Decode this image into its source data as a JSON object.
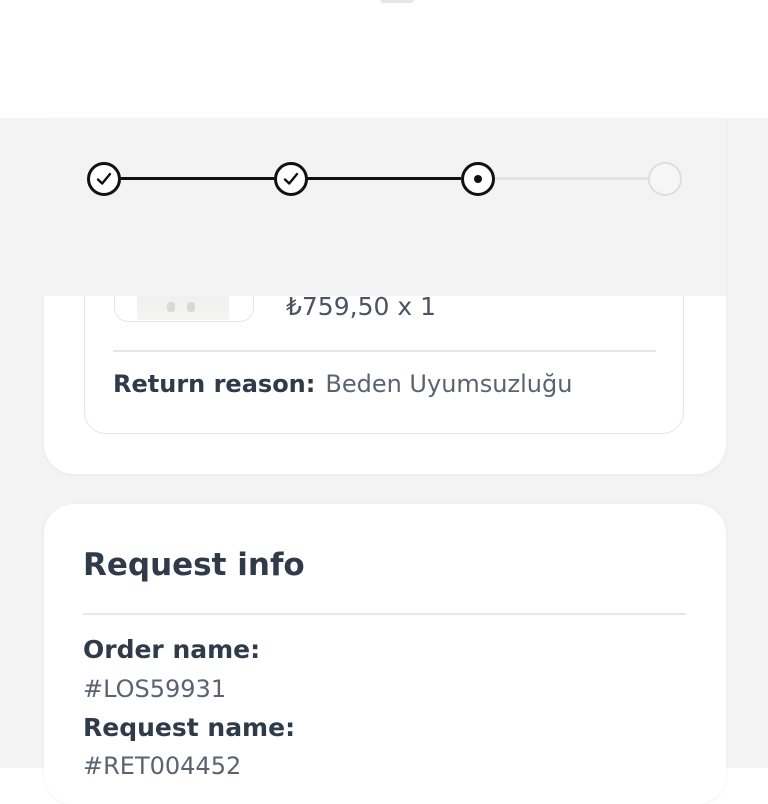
{
  "stepper": {
    "steps": [
      {
        "status": "done",
        "icon": "check-icon"
      },
      {
        "status": "done",
        "icon": "check-icon"
      },
      {
        "status": "current",
        "icon": "dot-icon"
      },
      {
        "status": "pending",
        "icon": "empty-circle-icon"
      }
    ],
    "colors": {
      "done": "#111111",
      "pending": "#e3e3e3"
    }
  },
  "return_item": {
    "price_quantity": "₺759,50 x 1",
    "reason_label": "Return reason:",
    "reason_value": "Beden Uyumsuzluğu"
  },
  "request_info": {
    "title": "Request info",
    "order_name_label": "Order name:",
    "order_name_value": "#LOS59931",
    "request_name_label": "Request name:",
    "request_name_value": "#RET004452"
  }
}
